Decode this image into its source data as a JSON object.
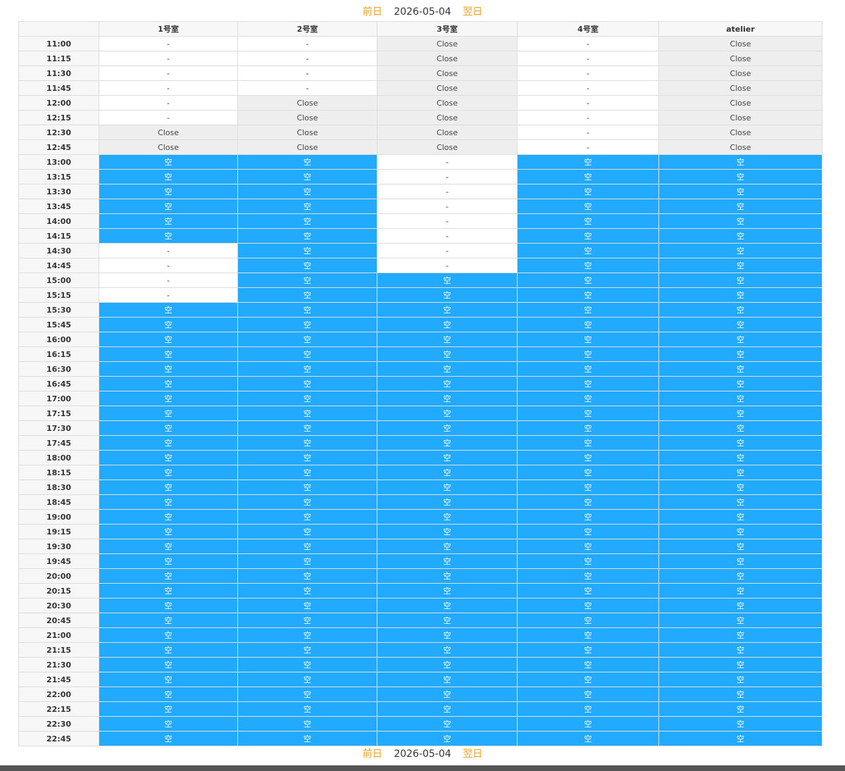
{
  "nav": {
    "prev": "前日",
    "date": "2026-05-04",
    "next": "翌日"
  },
  "rooms": [
    "1号室",
    "2号室",
    "3号室",
    "4号室",
    "atelier"
  ],
  "labels": {
    "empty": "-",
    "close": "Close",
    "available": "空"
  },
  "colors": {
    "available": "#22aaff",
    "close": "#eeeeee",
    "nav_link": "#f0a020"
  },
  "times": [
    "11:00",
    "11:15",
    "11:30",
    "11:45",
    "12:00",
    "12:15",
    "12:30",
    "12:45",
    "13:00",
    "13:15",
    "13:30",
    "13:45",
    "14:00",
    "14:15",
    "14:30",
    "14:45",
    "15:00",
    "15:15",
    "15:30",
    "15:45",
    "16:00",
    "16:15",
    "16:30",
    "16:45",
    "17:00",
    "17:15",
    "17:30",
    "17:45",
    "18:00",
    "18:15",
    "18:30",
    "18:45",
    "19:00",
    "19:15",
    "19:30",
    "19:45",
    "20:00",
    "20:15",
    "20:30",
    "20:45",
    "21:00",
    "21:15",
    "21:30",
    "21:45",
    "22:00",
    "22:15",
    "22:30",
    "22:45"
  ],
  "slots": [
    [
      "-",
      "-",
      "C",
      "-",
      "C"
    ],
    [
      "-",
      "-",
      "C",
      "-",
      "C"
    ],
    [
      "-",
      "-",
      "C",
      "-",
      "C"
    ],
    [
      "-",
      "-",
      "C",
      "-",
      "C"
    ],
    [
      "-",
      "C",
      "C",
      "-",
      "C"
    ],
    [
      "-",
      "C",
      "C",
      "-",
      "C"
    ],
    [
      "C",
      "C",
      "C",
      "-",
      "C"
    ],
    [
      "C",
      "C",
      "C",
      "-",
      "C"
    ],
    [
      "A",
      "A",
      "-",
      "A",
      "A"
    ],
    [
      "A",
      "A",
      "-",
      "A",
      "A"
    ],
    [
      "A",
      "A",
      "-",
      "A",
      "A"
    ],
    [
      "A",
      "A",
      "-",
      "A",
      "A"
    ],
    [
      "A",
      "A",
      "-",
      "A",
      "A"
    ],
    [
      "A",
      "A",
      "-",
      "A",
      "A"
    ],
    [
      "-",
      "A",
      "-",
      "A",
      "A"
    ],
    [
      "-",
      "A",
      "-",
      "A",
      "A"
    ],
    [
      "-",
      "A",
      "A",
      "A",
      "A"
    ],
    [
      "-",
      "A",
      "A",
      "A",
      "A"
    ],
    [
      "A",
      "A",
      "A",
      "A",
      "A"
    ],
    [
      "A",
      "A",
      "A",
      "A",
      "A"
    ],
    [
      "A",
      "A",
      "A",
      "A",
      "A"
    ],
    [
      "A",
      "A",
      "A",
      "A",
      "A"
    ],
    [
      "A",
      "A",
      "A",
      "A",
      "A"
    ],
    [
      "A",
      "A",
      "A",
      "A",
      "A"
    ],
    [
      "A",
      "A",
      "A",
      "A",
      "A"
    ],
    [
      "A",
      "A",
      "A",
      "A",
      "A"
    ],
    [
      "A",
      "A",
      "A",
      "A",
      "A"
    ],
    [
      "A",
      "A",
      "A",
      "A",
      "A"
    ],
    [
      "A",
      "A",
      "A",
      "A",
      "A"
    ],
    [
      "A",
      "A",
      "A",
      "A",
      "A"
    ],
    [
      "A",
      "A",
      "A",
      "A",
      "A"
    ],
    [
      "A",
      "A",
      "A",
      "A",
      "A"
    ],
    [
      "A",
      "A",
      "A",
      "A",
      "A"
    ],
    [
      "A",
      "A",
      "A",
      "A",
      "A"
    ],
    [
      "A",
      "A",
      "A",
      "A",
      "A"
    ],
    [
      "A",
      "A",
      "A",
      "A",
      "A"
    ],
    [
      "A",
      "A",
      "A",
      "A",
      "A"
    ],
    [
      "A",
      "A",
      "A",
      "A",
      "A"
    ],
    [
      "A",
      "A",
      "A",
      "A",
      "A"
    ],
    [
      "A",
      "A",
      "A",
      "A",
      "A"
    ],
    [
      "A",
      "A",
      "A",
      "A",
      "A"
    ],
    [
      "A",
      "A",
      "A",
      "A",
      "A"
    ],
    [
      "A",
      "A",
      "A",
      "A",
      "A"
    ],
    [
      "A",
      "A",
      "A",
      "A",
      "A"
    ],
    [
      "A",
      "A",
      "A",
      "A",
      "A"
    ],
    [
      "A",
      "A",
      "A",
      "A",
      "A"
    ],
    [
      "A",
      "A",
      "A",
      "A",
      "A"
    ],
    [
      "A",
      "A",
      "A",
      "A",
      "A"
    ]
  ]
}
